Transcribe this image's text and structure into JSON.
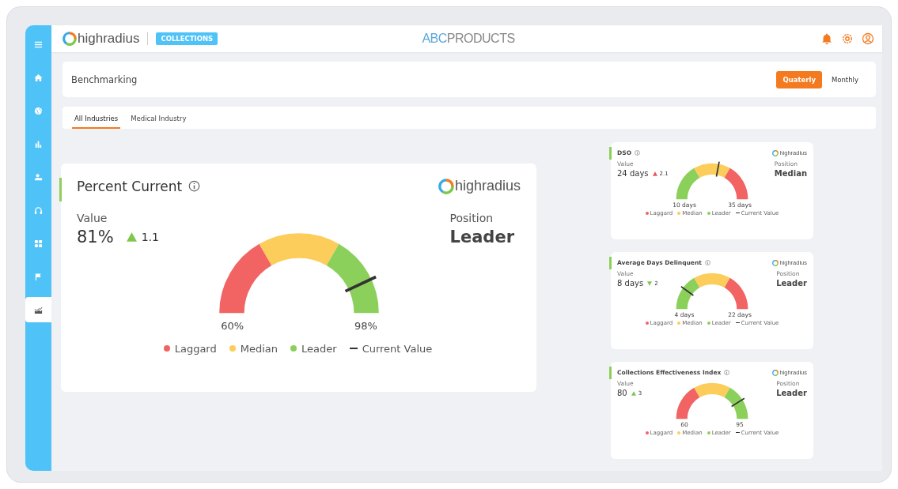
{
  "sidebar": {
    "items": [
      {
        "kind": "menu",
        "selected": false
      },
      {
        "kind": "home",
        "selected": false
      },
      {
        "kind": "globe",
        "selected": false
      },
      {
        "kind": "bars",
        "selected": false
      },
      {
        "kind": "people",
        "selected": false
      },
      {
        "kind": "headset",
        "selected": false
      },
      {
        "kind": "grid",
        "selected": false
      },
      {
        "kind": "flag",
        "selected": false
      },
      {
        "kind": "chart",
        "selected": true
      }
    ]
  },
  "header": {
    "logo": "highradius",
    "module": "COLLECTIONS",
    "brand": {
      "prefix": "ABC",
      "name": "PRODUCTS"
    }
  },
  "page_title": "Benchmarking",
  "periods": [
    {
      "label": "Quaterly",
      "selected": true
    },
    {
      "label": "Monthly",
      "selected": false
    }
  ],
  "tabs": [
    {
      "label": "All Industries",
      "selected": true
    },
    {
      "label": "Medical Industry",
      "selected": false
    }
  ],
  "main_card": {
    "title": "Percent Current",
    "logo": "highradius",
    "value_label": "Value",
    "value": "81%",
    "trend": {
      "up": true,
      "good": true,
      "value": "1.1"
    },
    "position_label": "Position",
    "position": "Leader",
    "gauge": {
      "leader_first": false,
      "min": "60%",
      "max": "98%"
    },
    "legend": [
      {
        "kind": "laggard",
        "label": "Laggard"
      },
      {
        "kind": "median",
        "label": "Median"
      },
      {
        "kind": "leader",
        "label": "Leader"
      },
      {
        "kind": "current",
        "label": "Current Value"
      }
    ]
  },
  "small_cards": [
    {
      "title": "DSO",
      "logo": "highradius",
      "value_label": "Value",
      "value": "24 days",
      "trend": {
        "up": true,
        "good": false,
        "value": "2.1"
      },
      "position_label": "Position",
      "position": "Median",
      "gauge": {
        "leader_first": true,
        "min": "10 days",
        "max": "35 days"
      },
      "legend": [
        {
          "kind": "laggard",
          "label": "Laggard"
        },
        {
          "kind": "median",
          "label": "Median"
        },
        {
          "kind": "leader",
          "label": "Leader"
        },
        {
          "kind": "current",
          "label": "Current Value"
        }
      ]
    },
    {
      "title": "Average Days Delinquent",
      "logo": "highradius",
      "value_label": "Value",
      "value": "8 days",
      "trend": {
        "up": false,
        "good": true,
        "value": "2"
      },
      "position_label": "Position",
      "position": "Leader",
      "gauge": {
        "leader_first": true,
        "min": "4 days",
        "max": "22 days"
      },
      "legend": [
        {
          "kind": "laggard",
          "label": "Laggard"
        },
        {
          "kind": "median",
          "label": "Median"
        },
        {
          "kind": "leader",
          "label": "Leader"
        },
        {
          "kind": "current",
          "label": "Current Value"
        }
      ]
    },
    {
      "title": "Collections Effectiveness Index",
      "logo": "highradius",
      "value_label": "Value",
      "value": "80",
      "trend": {
        "up": true,
        "good": true,
        "value": "3"
      },
      "position_label": "Position",
      "position": "Leader",
      "gauge": {
        "leader_first": false,
        "min": "60",
        "max": "95"
      },
      "legend": [
        {
          "kind": "laggard",
          "label": "Laggard"
        },
        {
          "kind": "median",
          "label": "Median"
        },
        {
          "kind": "leader",
          "label": "Leader"
        },
        {
          "kind": "current",
          "label": "Current Value"
        }
      ]
    }
  ]
}
